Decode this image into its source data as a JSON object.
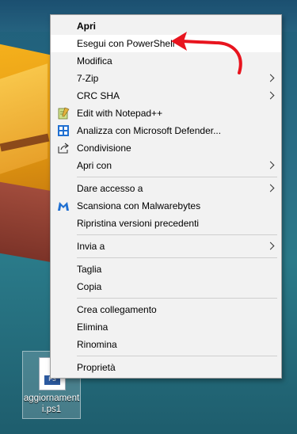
{
  "desktop": {
    "file_icon": {
      "label": "aggiornamenti.ps1",
      "badge": "PS"
    }
  },
  "context_menu": {
    "items": [
      {
        "label": "Apri",
        "bold": true
      },
      {
        "label": "Esegui con PowerShell"
      },
      {
        "label": "Modifica"
      },
      {
        "label": "7-Zip",
        "submenu": true
      },
      {
        "label": "CRC SHA",
        "submenu": true
      },
      {
        "label": "Edit with Notepad++",
        "icon": "notepadpp-icon"
      },
      {
        "label": "Analizza con Microsoft Defender...",
        "icon": "defender-shield-icon"
      },
      {
        "label": "Condivisione",
        "icon": "share-icon"
      },
      {
        "label": "Apri con",
        "submenu": true
      },
      {
        "label": "Dare accesso a",
        "submenu": true
      },
      {
        "label": "Scansiona con Malwarebytes",
        "icon": "malwarebytes-icon"
      },
      {
        "label": "Ripristina versioni precedenti"
      },
      {
        "label": "Invia a",
        "submenu": true
      },
      {
        "label": "Taglia"
      },
      {
        "label": "Copia"
      },
      {
        "label": "Crea collegamento"
      },
      {
        "label": "Elimina"
      },
      {
        "label": "Rinomina"
      },
      {
        "label": "Proprietà"
      }
    ]
  },
  "annotation": {
    "color": "#e8141e"
  }
}
